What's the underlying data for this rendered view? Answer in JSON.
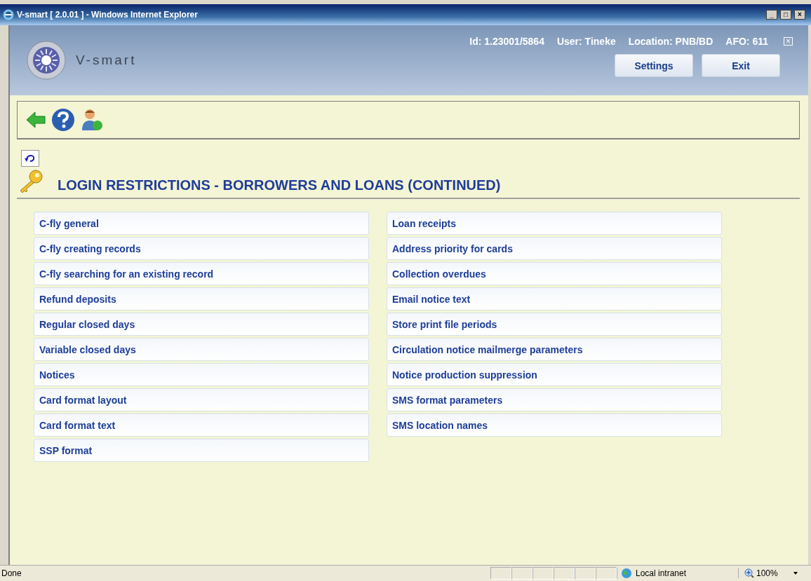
{
  "window": {
    "title": "V-smart [ 2.0.01 ] - Windows Internet Explorer",
    "controls": [
      "_",
      "□",
      "×"
    ]
  },
  "header": {
    "logo_text": "V-smart",
    "info": [
      "Id: 1.23001/5864",
      "User: Tineke",
      "Location: PNB/BD",
      "AFO: 611"
    ],
    "close": "×",
    "buttons": [
      "Settings",
      "Exit"
    ]
  },
  "page": {
    "title": "LOGIN RESTRICTIONS - BORROWERS AND LOANS (CONTINUED)",
    "columns": [
      [
        "C-fly general",
        "C-fly creating records",
        "C-fly searching for an existing record",
        "Refund deposits",
        "Regular closed days",
        "Variable closed days",
        "Notices",
        "Card format layout",
        "Card format text",
        "SSP format"
      ],
      [
        "Loan receipts",
        "Address priority for cards",
        "Collection overdues",
        "Email notice text",
        "Store print file periods",
        "Circulation notice mailmerge parameters",
        "Notice production suppression",
        "SMS format parameters",
        "SMS location names"
      ]
    ]
  },
  "status_bar": {
    "status": "Done",
    "zone": "Local intranet",
    "zoom": "100%"
  }
}
